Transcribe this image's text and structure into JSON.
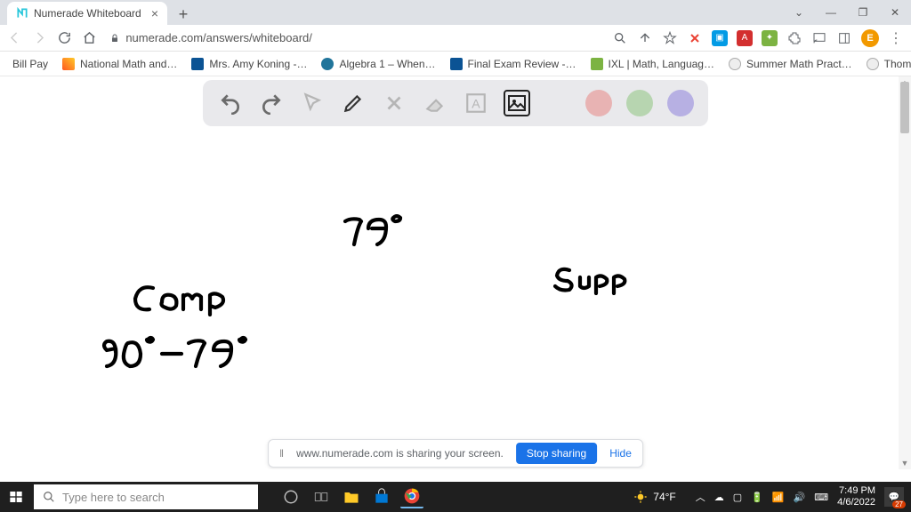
{
  "tab": {
    "title": "Numerade Whiteboard"
  },
  "url": "numerade.com/answers/whiteboard/",
  "profile_letter": "E",
  "bookmarks": [
    {
      "label": "Bill Pay",
      "color": "#ffffff"
    },
    {
      "label": "National Math and…",
      "color": "#ff5722"
    },
    {
      "label": "Mrs. Amy Koning -…",
      "color": "#0b5394"
    },
    {
      "label": "Algebra 1 – When…",
      "color": "#21759b"
    },
    {
      "label": "Final Exam Review -…",
      "color": "#0b5394"
    },
    {
      "label": "IXL | Math, Languag…",
      "color": "#f6c026"
    },
    {
      "label": "Summer Math Pract…",
      "color": "#888888"
    },
    {
      "label": "Thomastik-Infeld C…",
      "color": "#888888"
    }
  ],
  "colors": {
    "black": "#111111",
    "pink": "#e8b3b3",
    "green": "#b7d5b0",
    "purple": "#b7b0e3"
  },
  "whiteboard": {
    "angle": "79°",
    "label_left": "Comp",
    "equation": "90° − 79°",
    "label_right": "Supp"
  },
  "share": {
    "text": "www.numerade.com is sharing your screen.",
    "stop": "Stop sharing",
    "hide": "Hide"
  },
  "taskbar": {
    "search_placeholder": "Type here to search",
    "temp": "74°F",
    "time": "7:49 PM",
    "date": "4/6/2022",
    "notif_count": "27"
  }
}
